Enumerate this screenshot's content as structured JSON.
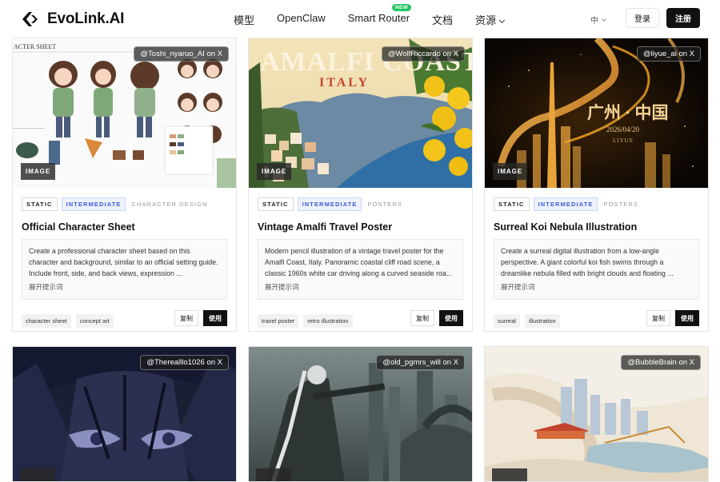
{
  "header": {
    "logo_text": "EvoLink.AI",
    "nav": [
      {
        "label": "模型"
      },
      {
        "label": "OpenClaw"
      },
      {
        "label": "Smart Router",
        "badge": "NEW"
      },
      {
        "label": "文档"
      },
      {
        "label": "资源"
      }
    ],
    "lang": "中",
    "login": "登录",
    "register": "注册"
  },
  "cards": [
    {
      "credit": "@Toshi_nyaruo_AI on X",
      "media_label": "IMAGE",
      "tags": [
        "STATIC",
        "INTERMEDIATE"
      ],
      "category": "CHARACTER DESIGN",
      "title": "Official Character Sheet",
      "prompt": "Create a professional character sheet based on this character and background, similar to an official setting guide. Include front, side, and back views, expression ...",
      "expand": "展开提示词",
      "chips": [
        "character sheet",
        "concept art"
      ],
      "copy": "复制",
      "use": "使用",
      "image_text": {
        "head": "ACTER SHEET"
      }
    },
    {
      "credit": "@WolfRiccardo on X",
      "media_label": "IMAGE",
      "tags": [
        "STATIC",
        "INTERMEDIATE"
      ],
      "category": "POSTERS",
      "title": "Vintage Amalfi Travel Poster",
      "prompt": "Modern pencil illustration of a vintage travel poster for the Amalfi Coast, Italy. Panoramic coastal cliff road scene, a classic 1960s white car driving along a curved seaside roa...",
      "expand": "展开提示词",
      "chips": [
        "travel poster",
        "retro illustration"
      ],
      "copy": "复制",
      "use": "使用",
      "image_text": {
        "line1": "AMALFI COAST",
        "line2": "ITALY"
      }
    },
    {
      "credit": "@liyue_ai on X",
      "media_label": "IMAGE",
      "tags": [
        "STATIC",
        "INTERMEDIATE"
      ],
      "category": "POSTERS",
      "title": "Surreal Koi Nebula Illustration",
      "prompt": "Create a surreal digital illustration from a low-angle perspective. A giant colorful koi fish swims through a dreamlike nebula filled with bright clouds and floating ...",
      "expand": "展开提示词",
      "chips": [
        "surreal",
        "illustration"
      ],
      "copy": "复制",
      "use": "使用",
      "image_text": {
        "line1": "广州 · 中国",
        "line2": "2026/04/20",
        "line3": "LIYUE"
      }
    }
  ],
  "row2": [
    {
      "credit": "@Therealllo1026 on X"
    },
    {
      "credit": "@old_pgmrs_will on X"
    },
    {
      "credit": "@BubbleBrain on X"
    }
  ],
  "colors": {
    "accent": "#3b5bd6",
    "black": "#111111",
    "new_badge": "#22c55e"
  }
}
